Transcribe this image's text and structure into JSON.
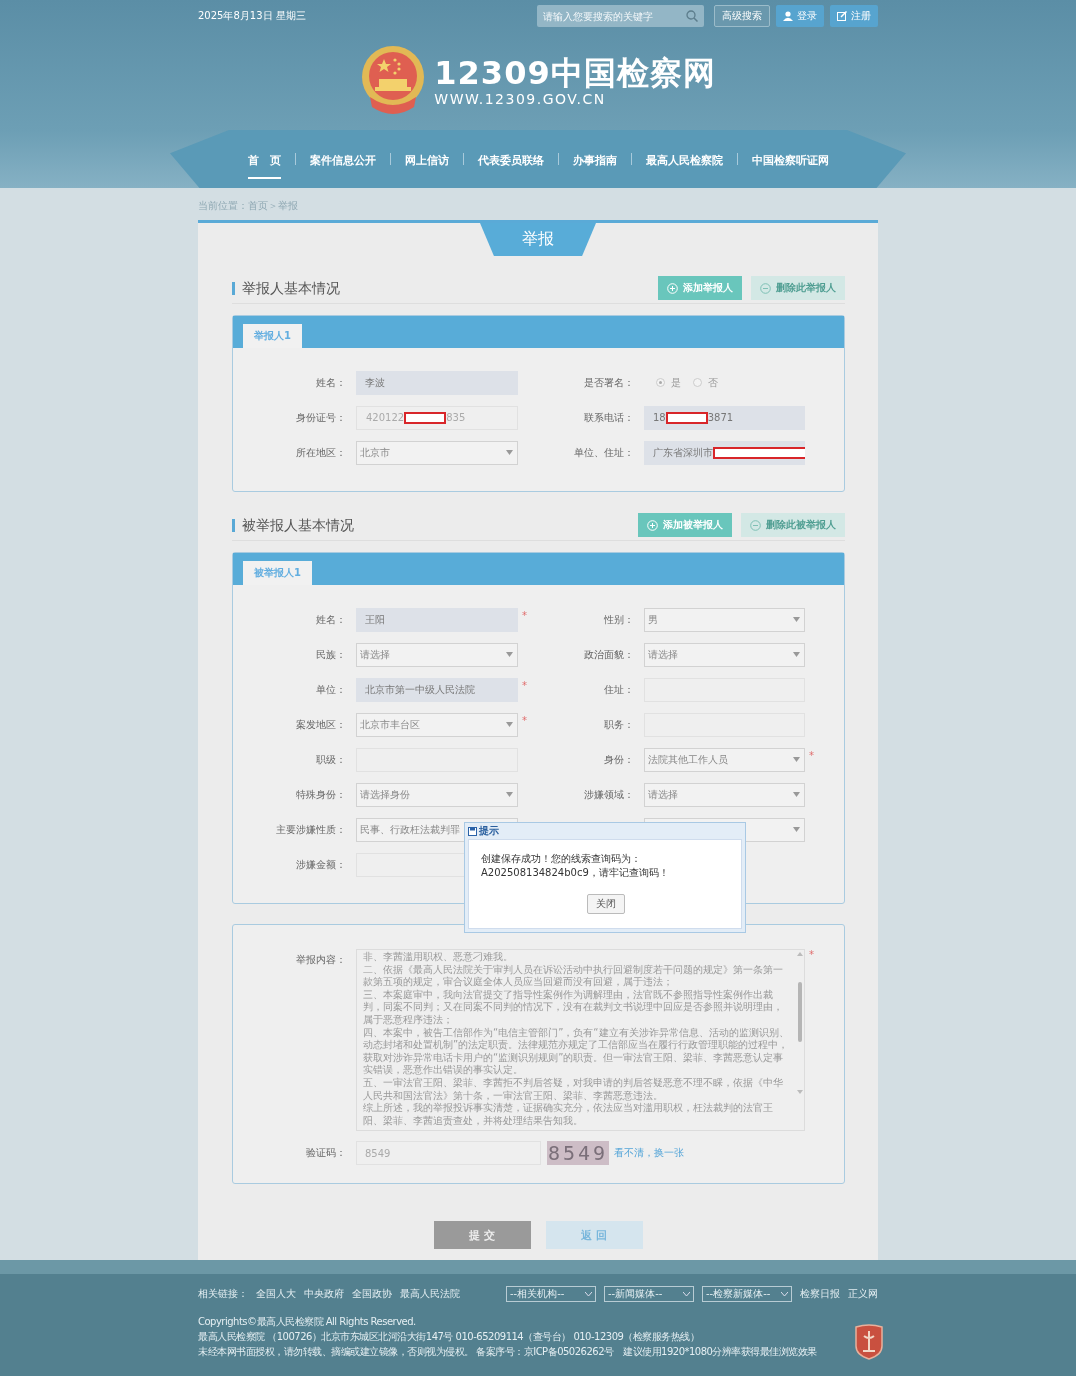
{
  "top_bar": {
    "date": "2025年8月13日 星期三",
    "search": {
      "placeholder": "请输入您要搜索的关键字"
    },
    "buttons": [
      {
        "label": "高级搜索",
        "kind": "advanced"
      },
      {
        "label": "登录",
        "kind": "login"
      },
      {
        "label": "注册",
        "kind": "register"
      }
    ]
  },
  "logo": {
    "title": "12309中国检察网",
    "url": "WWW.12309.GOV.CN"
  },
  "nav": [
    {
      "label": "首　页",
      "selected": true
    },
    {
      "label": "案件信息公开",
      "selected": false
    },
    {
      "label": "网上信访",
      "selected": false
    },
    {
      "label": "代表委员联络",
      "selected": false
    },
    {
      "label": "办事指南",
      "selected": false
    },
    {
      "label": "最高人民检察院",
      "selected": false
    },
    {
      "label": "中国检察听证网",
      "selected": false
    }
  ],
  "breadcrumb": "当前位置：首页＞举报",
  "page_title": "举报",
  "reporter": {
    "title": "举报人基本情况",
    "buttons": [
      {
        "label": "添加举报人",
        "kind": "add"
      },
      {
        "label": "删除此举报人",
        "kind": "remove"
      }
    ],
    "tabs": [
      {
        "label": "举报人1",
        "selected": true
      }
    ],
    "rows": [
      {
        "left": {
          "label": "姓名：",
          "kind": "input",
          "value": "李波",
          "highlighted": true
        },
        "right": {
          "label": "是否署名：",
          "kind": "radio",
          "options": [
            {
              "label": "是",
              "selected": true
            },
            {
              "label": "否",
              "selected": false
            }
          ]
        }
      },
      {
        "left": {
          "label": "身份证号：",
          "kind": "input",
          "value": "420122",
          "redacted": true,
          "value_after": "835",
          "highlighted": false
        },
        "right": {
          "label": "联系电话：",
          "kind": "input",
          "value": "18",
          "redacted": true,
          "value_after": "3871",
          "highlighted": true
        }
      },
      {
        "left": {
          "label": "所在地区：",
          "kind": "select",
          "value": "北京市"
        },
        "right": {
          "label": "单位、住址：",
          "kind": "input",
          "value": "广东省深圳市",
          "redacted": true,
          "highlighted": true
        }
      }
    ]
  },
  "accused": {
    "title": "被举报人基本情况",
    "buttons": [
      {
        "label": "添加被举报人",
        "kind": "add"
      },
      {
        "label": "删除此被举报人",
        "kind": "remove"
      }
    ],
    "tabs": [
      {
        "label": "被举报人1",
        "selected": true
      }
    ],
    "rows": [
      {
        "left": {
          "label": "姓名：",
          "kind": "input",
          "value": "王阳",
          "highlighted": true,
          "required_mark": "*"
        },
        "right": {
          "label": "性别：",
          "kind": "select",
          "value": "男"
        }
      },
      {
        "left": {
          "label": "民族：",
          "kind": "select",
          "value": "请选择"
        },
        "right": {
          "label": "政治面貌：",
          "kind": "select",
          "value": "请选择"
        }
      },
      {
        "left": {
          "label": "单位：",
          "kind": "input",
          "value": "北京市第一中级人民法院",
          "highlighted": true,
          "required_mark": "*"
        },
        "right": {
          "label": "住址：",
          "kind": "input",
          "highlighted": false
        }
      },
      {
        "left": {
          "label": "案发地区：",
          "kind": "select",
          "value": "北京市丰台区",
          "required_mark": "*"
        },
        "right": {
          "label": "职务：",
          "kind": "input",
          "highlighted": false
        }
      },
      {
        "left": {
          "label": "职级：",
          "kind": "input",
          "highlighted": false
        },
        "right": {
          "label": "身份：",
          "kind": "select",
          "value": "法院其他工作人员",
          "required_mark": "*"
        }
      },
      {
        "left": {
          "label": "特殊身份：",
          "kind": "select",
          "value": "请选择身份"
        },
        "right": {
          "label": "涉嫌领域：",
          "kind": "select",
          "value": "请选择"
        }
      },
      {
        "left": {
          "label": "主要涉嫌性质：",
          "kind": "select",
          "value": "民事、行政枉法裁判罪"
        },
        "right": {
          "kind": "select"
        }
      },
      {
        "left": {
          "label": "涉嫌金额：",
          "kind": "input",
          "highlighted": false
        }
      }
    ]
  },
  "report": {
    "content_label": "举报内容：",
    "content": [
      "非、李茜滥用职权、恶意刁难我。",
      "二、依据《最高人民法院关于审判人员在诉讼活动中执行回避制度若干问题的规定》第一条第一款第五项的规定，审合议庭全体人员应当回避而没有回避，属于违法；",
      "三、本案庭审中，我向法官提交了指导性案例作为调解理由，法官既不参照指导性案例作出裁判，同案不同判；又在同案不同判的情况下，没有在裁判文书说理中回应是否参照并说明理由，属于恶意程序违法；",
      "四、本案中，被告工信部作为“电信主管部门”，负有“建立有关涉诈异常信息、活动的监测识别、动态封堵和处置机制”的法定职责。法律规范亦规定了工信部应当在履行行政管理职能的过程中，获取对涉诈异常电话卡用户的“监测识别规则”的职责。但一审法官王阳、梁菲、李茜恶意认定事实错误，恶意作出错误的事实认定。",
      "五、一审法官王阳、梁菲、李茜拒不判后答疑，对我申请的判后答疑恶意不理不睬，依据《中华人民共和国法官法》第十条，一审法官王阳、梁菲、李茜恶意违法。",
      "综上所述，我的举报投诉事实清楚，证据确实充分，依法应当对滥用职权，枉法裁判的法官王阳、梁菲、李茜追责查处，并将处理结果告知我。"
    ],
    "required_mark": "*",
    "captcha_label": "验证码：",
    "captcha_value": "8549",
    "captcha_image": "8549",
    "refresh_link": "看不清，换一张"
  },
  "actions": [
    {
      "label": "提 交",
      "kind": "submit"
    },
    {
      "label": "返 回",
      "kind": "back"
    }
  ],
  "dialog": {
    "title": "提示",
    "message": "创建保存成功！您的线索查询码为：  A202508134824b0c9，请牢记查询码！",
    "button": "关闭"
  },
  "footer": {
    "links_label": "相关链接：",
    "links": [
      "全国人大",
      "中央政府",
      "全国政协",
      "最高人民法院"
    ],
    "selects": [
      "--相关机构--",
      "--新闻媒体--",
      "--检察新媒体--"
    ],
    "extra_links": [
      "检察日报",
      "正义网"
    ],
    "lines": [
      "Copyrights©最高人民检察院 All Rights Reserved.",
      "最高人民检察院 （100726）北京市东城区北河沿大街147号 010-65209114（查号台） 010-12309（检察服务热线）",
      "未经本网书面授权，请勿转载、摘编或建立镜像，否则视为侵权。 备案序号：京ICP备05026262号　建议使用1920*1080分辨率获得最佳浏览效果"
    ]
  }
}
